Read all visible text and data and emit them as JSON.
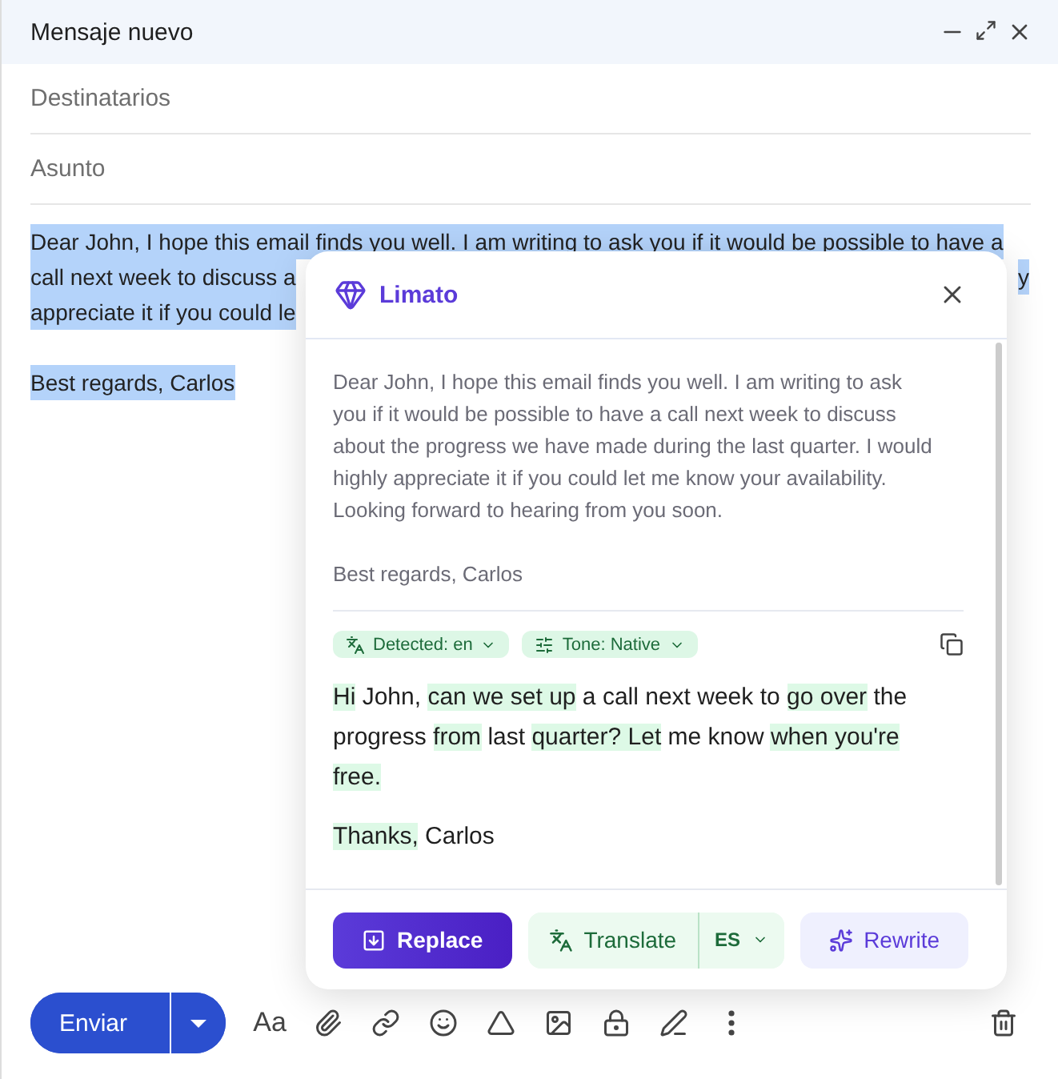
{
  "window": {
    "title": "Mensaje nuevo"
  },
  "fields": [
    {
      "placeholder": "Destinatarios"
    },
    {
      "placeholder": "Asunto"
    }
  ],
  "body": {
    "line_1": "Dear John, I hope this email finds you well. I am writing to ask you if it would be possible to have a",
    "line_2": "call next week to discuss a",
    "line_2_end": "y",
    "line_3": "appreciate it if you could le",
    "signature": "Best regards, Carlos"
  },
  "assistant": {
    "title": "Limato",
    "original": [
      "Dear John, I hope this email finds you well. I am writing to ask you if it would be possible to have a call next week to discuss about the progress we have made during the last quarter. I would highly appreciate it if you could let me know your availability. Looking forward to hearing from you soon.",
      "Best regards, Carlos"
    ],
    "chips": [
      "Detected: en",
      "Tone: Native"
    ],
    "result": [
      [
        {
          "text": "Hi",
          "changed": true
        },
        {
          "text": " John, ",
          "changed": false
        },
        {
          "text": "can we set up",
          "changed": true
        },
        {
          "text": " a call next week to ",
          "changed": false
        },
        {
          "text": "go over",
          "changed": true
        },
        {
          "text": " the progress ",
          "changed": false
        },
        {
          "text": "from",
          "changed": true
        },
        {
          "text": " last ",
          "changed": false
        },
        {
          "text": "quarter? Let",
          "changed": true
        },
        {
          "text": " me know ",
          "changed": false
        },
        {
          "text": "when you're free.",
          "changed": true
        }
      ],
      [
        {
          "text": "Thanks,",
          "changed": true
        },
        {
          "text": " Carlos",
          "changed": false
        }
      ]
    ],
    "buttons": {
      "replace": "Replace",
      "translate": "Translate",
      "language": "ES",
      "rewrite": "Rewrite"
    }
  },
  "toolbar": {
    "send": "Enviar",
    "format": "Aa"
  }
}
